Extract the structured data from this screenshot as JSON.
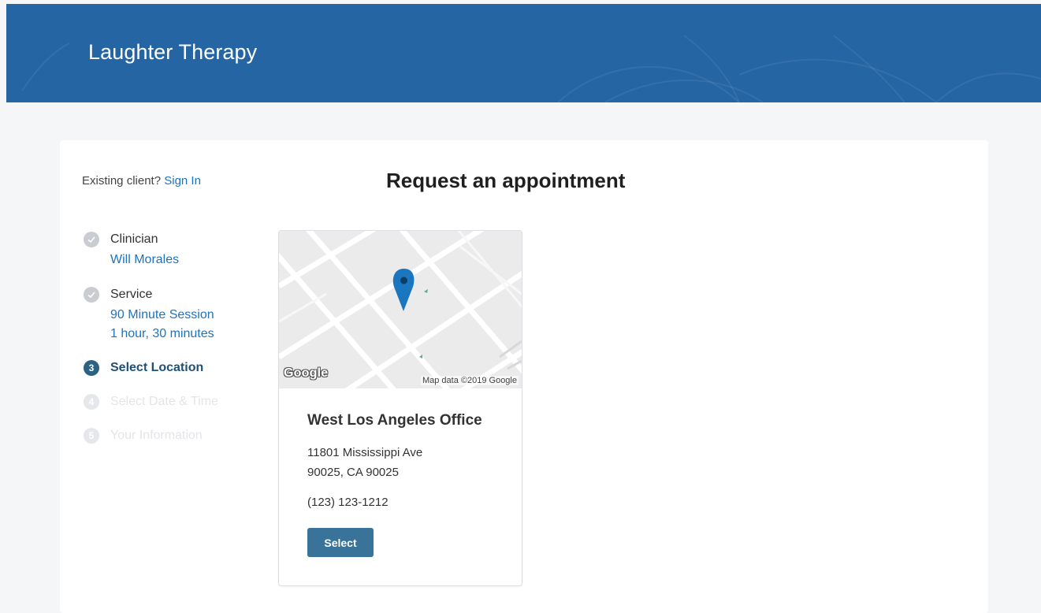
{
  "header": {
    "brand": "Laughter Therapy",
    "background_color": "#2565a4"
  },
  "auth": {
    "prompt": "Existing client?",
    "sign_in_label": "Sign In"
  },
  "page": {
    "title": "Request an appointment"
  },
  "steps": [
    {
      "number": "",
      "label": "Clinician",
      "status": "done",
      "details": [
        "Will Morales"
      ]
    },
    {
      "number": "",
      "label": "Service",
      "status": "done",
      "details": [
        "90 Minute Session",
        "1 hour, 30 minutes"
      ]
    },
    {
      "number": "3",
      "label": "Select Location",
      "status": "active",
      "details": []
    },
    {
      "number": "4",
      "label": "Select Date & Time",
      "status": "inactive",
      "details": []
    },
    {
      "number": "5",
      "label": "Your Information",
      "status": "inactive",
      "details": []
    }
  ],
  "location": {
    "map": {
      "google_logo": "Google",
      "attribution": "Map data ©2019 Google",
      "marker_icon": "map-pin-icon"
    },
    "name": "West Los Angeles Office",
    "address_line1": "11801 Mississippi Ave",
    "address_line2": "90025, CA 90025",
    "phone": "(123) 123-1212",
    "select_label": "Select"
  },
  "colors": {
    "accent": "#1e73be",
    "button": "#3a7399",
    "active_step": "#2d6183"
  }
}
